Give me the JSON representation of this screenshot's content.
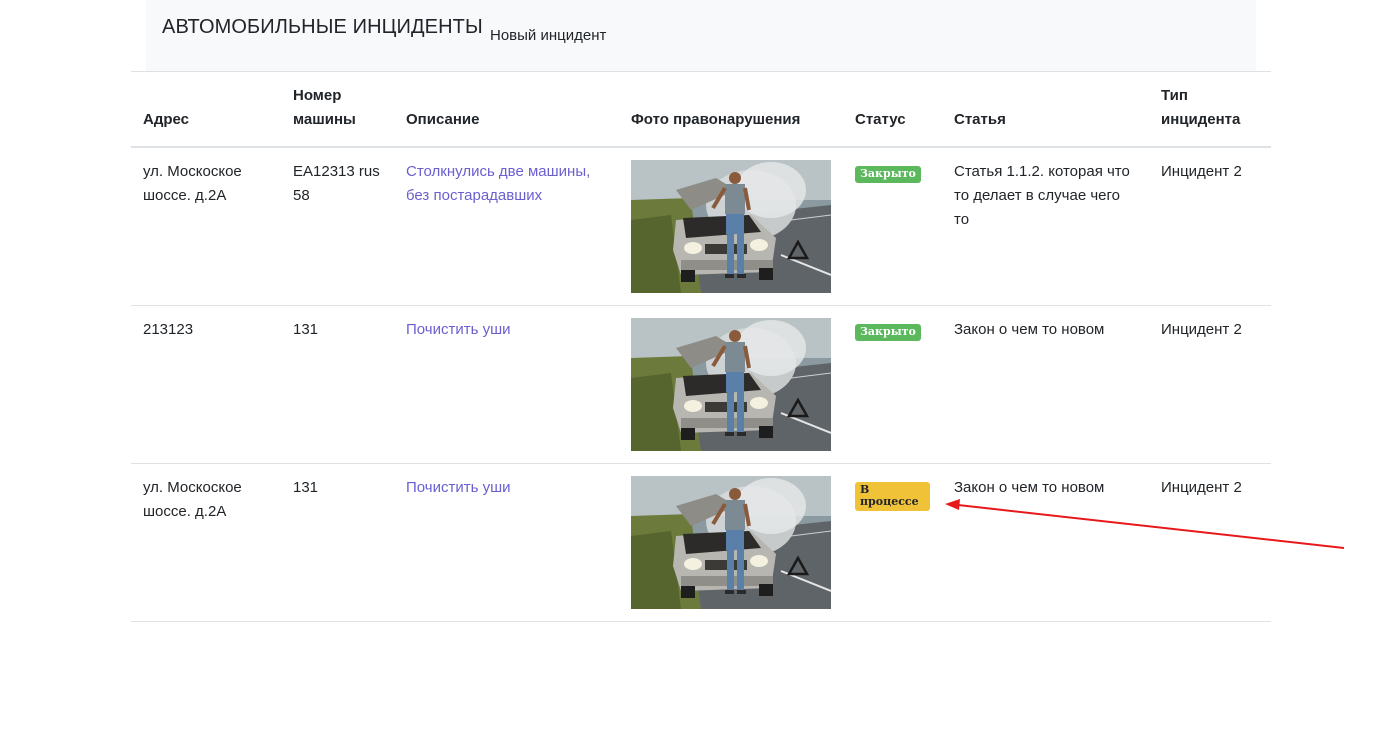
{
  "navbar": {
    "brand": "АВТОМОБИЛЬНЫЕ ИНЦИДЕНТЫ",
    "new_incident": "Новый инцидент"
  },
  "table": {
    "headers": [
      "Адрес",
      "Номер машины",
      "Описание",
      "Фото правонарушения",
      "Статус",
      "Статья",
      "Тип инцидента"
    ],
    "rows": [
      {
        "address": "ул. Москоское шоссе. д.2А",
        "car_number": "ЕА12313 rus 58",
        "description": "Столкнулись две машины, без постарадавших",
        "status": "Закрыто",
        "article": "Статья 1.1.2. которая что то делает в случае чего то",
        "type": "Инцидент 2"
      },
      {
        "address": "213123",
        "car_number": "131",
        "description": "Почистить уши",
        "status": "Закрыто",
        "article": "Закон о чем то новом",
        "type": "Инцидент 2"
      },
      {
        "address": "ул. Москоское шоссе. д.2А",
        "car_number": "131",
        "description": "Почистить уши",
        "status": "В процессе",
        "article": "Закон о чем то новом",
        "type": "Инцидент 2"
      }
    ]
  },
  "colors": {
    "status_closed": "#5cb85c",
    "status_in_progress": "#f0c238",
    "link": "#6a5fcf",
    "annotation_arrow": "#e8191a"
  },
  "icons": {
    "photo": "car-breakdown-photo",
    "annotation": "red-arrow-annotation"
  }
}
